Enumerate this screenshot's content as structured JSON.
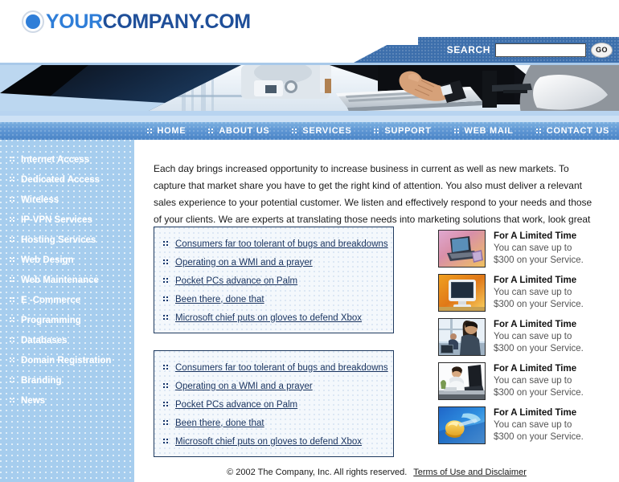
{
  "site": {
    "logo_icon": "circle-logo-icon",
    "logo_part1": "YOUR",
    "logo_part2": "COMPANY",
    "logo_part3": ".COM"
  },
  "search": {
    "label": "SEARCH",
    "value": "",
    "placeholder": "",
    "go_label": "GO",
    "band_color": "#3d6fac"
  },
  "banner": {
    "alt": "person typing on keyboard at computer workstation"
  },
  "nav": {
    "accent_color": "#5b92d0",
    "items": [
      {
        "label": "HOME"
      },
      {
        "label": "ABOUT US"
      },
      {
        "label": "SERVICES"
      },
      {
        "label": "SUPPORT"
      },
      {
        "label": "WEB MAIL"
      },
      {
        "label": "CONTACT US"
      }
    ]
  },
  "sidebar": {
    "bg_color": "#a6cdee",
    "items": [
      {
        "label": "Internet Access"
      },
      {
        "label": "Dedicated Access"
      },
      {
        "label": "Wireless"
      },
      {
        "label": "IP-VPN Services"
      },
      {
        "label": "Hosting Services"
      },
      {
        "label": "Web Design"
      },
      {
        "label": "Web Maintenance"
      },
      {
        "label": "E -Commerce"
      },
      {
        "label": "Programming"
      },
      {
        "label": "Databases"
      },
      {
        "label": "Domain Registration"
      },
      {
        "label": "Branding"
      },
      {
        "label": "News"
      }
    ]
  },
  "main": {
    "intro": "Each day brings increased opportunity to increase business in current as well as new markets. To capture that market share you have to get the right kind of attention. You also must deliver a relevant sales experience to your potential customer. We listen and effectively respond to your needs and those of your clients. We are experts at translating those needs into marketing solutions that work, look great and communicate well.",
    "news_boxes": [
      {
        "items": [
          {
            "label": "Consumers far too tolerant of bugs and breakdowns"
          },
          {
            "label": "Operating on a WMI and a prayer"
          },
          {
            "label": "Pocket PCs advance on Palm"
          },
          {
            "label": "Been there, done that"
          },
          {
            "label": "Microsoft chief puts on gloves to defend Xbox"
          }
        ]
      },
      {
        "items": [
          {
            "label": "Consumers far too tolerant of bugs and breakdowns"
          },
          {
            "label": "Operating on a WMI and a prayer"
          },
          {
            "label": "Pocket PCs advance on Palm"
          },
          {
            "label": "Been there, done that"
          },
          {
            "label": "Microsoft chief puts on gloves to defend Xbox"
          }
        ]
      }
    ],
    "promos": [
      {
        "thumb": "laptop-thumb-icon",
        "title": "For A Limited Time",
        "line1": "You can save up to",
        "line2": "$300 on your Service."
      },
      {
        "thumb": "monitor-thumb-icon",
        "title": "For A Limited Time",
        "line1": "You can save up to",
        "line2": "$300 on your Service."
      },
      {
        "thumb": "office-worker-thumb-icon",
        "title": "For A Limited Time",
        "line1": "You can save up to",
        "line2": "$300 on your Service."
      },
      {
        "thumb": "desk-worker-thumb-icon",
        "title": "For A Limited Time",
        "line1": "You can save up to",
        "line2": "$300 on your Service."
      },
      {
        "thumb": "mouse-thumb-icon",
        "title": "For A Limited Time",
        "line1": "You can save up to",
        "line2": "$300 on your Service."
      }
    ]
  },
  "footer": {
    "copyright": "© 2002 The Company, Inc. All rights reserved.",
    "terms_link": "Terms of Use and Disclaimer"
  }
}
